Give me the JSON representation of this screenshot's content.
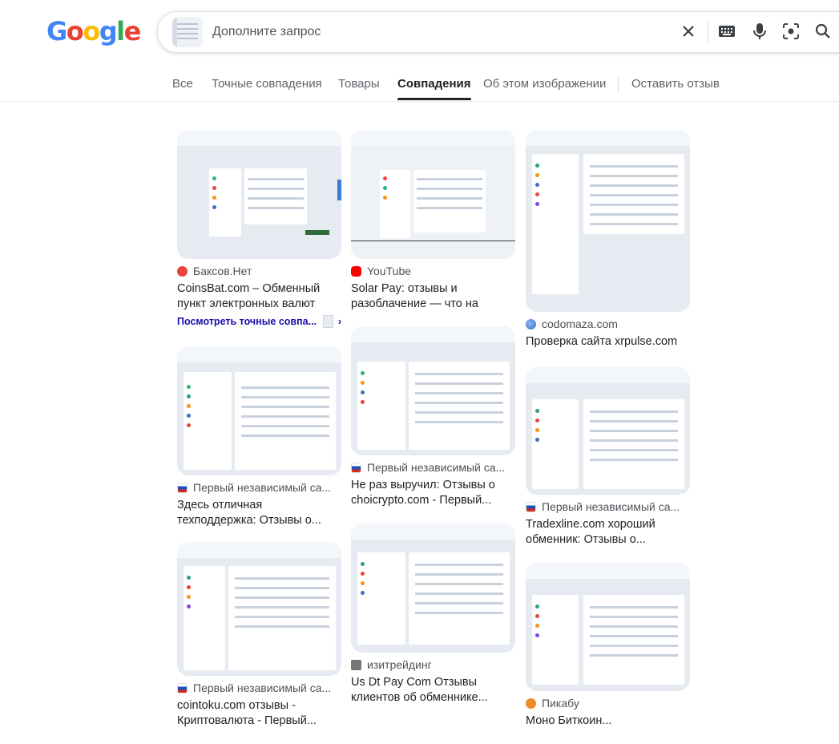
{
  "logo": {
    "letters": [
      "G",
      "o",
      "o",
      "g",
      "l",
      "e"
    ],
    "colors": [
      "#4285F4",
      "#EA4335",
      "#FBBC05",
      "#4285F4",
      "#34A853",
      "#EA4335"
    ]
  },
  "search": {
    "placeholder": "Дополните запрос"
  },
  "icons": {
    "clear": "close-icon",
    "keyboard": "keyboard-icon",
    "voice": "mic-icon",
    "lens": "lens-icon",
    "search": "search-icon"
  },
  "tabs": [
    {
      "label": "Все",
      "active": false
    },
    {
      "label": "Точные совпадения",
      "active": false
    },
    {
      "label": "Товары",
      "active": false
    },
    {
      "label": "Совпадения",
      "active": true
    },
    {
      "label": "Об этом изображении",
      "active": false
    },
    {
      "label": "Оставить отзыв",
      "active": false
    }
  ],
  "results": [
    {
      "source": "Баксов.Нет",
      "favicon": "bak",
      "title": "CoinsBat.com – Обменный пункт электронных валют",
      "exact_link": "Посмотреть точные совпа..."
    },
    {
      "source": "Первый независимый са...",
      "favicon": "ru",
      "title": "Здесь отличная техподдержка: Отзывы о..."
    },
    {
      "source": "Первый независимый са...",
      "favicon": "ru",
      "title": "cointoku.com отзывы - Криптовалюта - Первый..."
    },
    {
      "source": "YouTube",
      "favicon": "yt",
      "title": "Solar Pay: отзывы и разоблачение — что на само..."
    },
    {
      "source": "Первый независимый са...",
      "favicon": "ru",
      "title": "Не раз выручил: Отзывы о choicrypto.com - Первый..."
    },
    {
      "source": "изитрейдинг",
      "favicon": "izi",
      "title": "Us Dt Pay Com Отзывы клиентов об обменнике..."
    },
    {
      "source": "codomaza.com",
      "favicon": "globe",
      "title": "Проверка сайта xrpulse.com"
    },
    {
      "source": "Первый независимый са...",
      "favicon": "ru",
      "title": "Tradexline.com хороший обменник: Отзывы о..."
    },
    {
      "source": "Пикабу",
      "favicon": "pik",
      "title": "Моно Биткоин..."
    }
  ]
}
